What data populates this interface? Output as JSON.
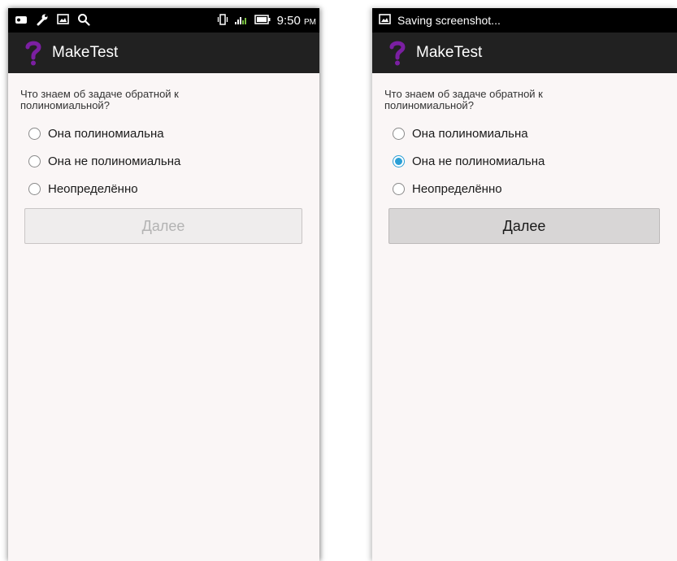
{
  "left_screen": {
    "status": {
      "time": "9:50",
      "ampm": "PM"
    },
    "app": {
      "title": "MakeTest"
    },
    "question": "Что знаем об задаче обратной к полиномиальной?",
    "options": [
      {
        "label": "Она полиномиальна",
        "checked": false
      },
      {
        "label": "Она не полиномиальна",
        "checked": false
      },
      {
        "label": "Неопределённо",
        "checked": false
      }
    ],
    "next_label": "Далее",
    "next_enabled": false
  },
  "right_screen": {
    "status": {
      "text": "Saving screenshot..."
    },
    "app": {
      "title": "MakeTest"
    },
    "question": "Что знаем об задаче обратной к полиномиальной?",
    "options": [
      {
        "label": "Она полиномиальна",
        "checked": false
      },
      {
        "label": "Она не полиномиальна",
        "checked": true
      },
      {
        "label": "Неопределённо",
        "checked": false
      }
    ],
    "next_label": "Далее",
    "next_enabled": true
  },
  "colors": {
    "logo_purple": "#7b1fa2",
    "radio_accent": "#2a9fd6",
    "appbar": "#212121"
  },
  "icons": {
    "statusbar_left": [
      "notification-icon",
      "wrench-icon",
      "gallery-icon",
      "search-icon"
    ],
    "statusbar_right": [
      "vibrate-icon",
      "signal-icon",
      "battery-icon"
    ],
    "screenshot_status": "image-icon",
    "app_logo": "question-mark-icon"
  }
}
